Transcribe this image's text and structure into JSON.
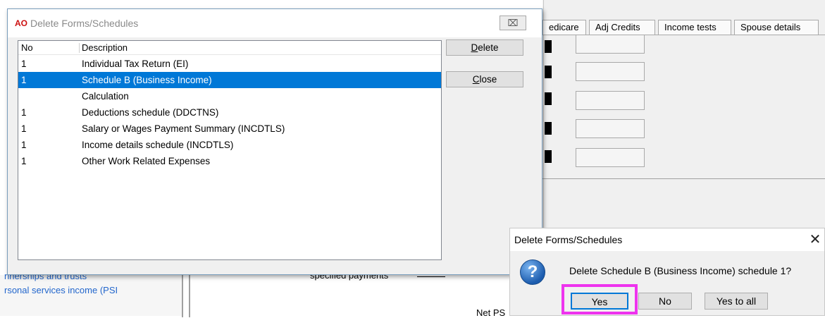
{
  "background": {
    "tabs": [
      "edicare",
      "Adj Credits",
      "Income tests",
      "Spouse details"
    ],
    "links": [
      "nnerships and trusts",
      "rsonal services income (PSI"
    ],
    "specified_payments_label": "specified payments",
    "net_psi_label": "Net PS"
  },
  "dialog": {
    "logo": "AO",
    "title": "Delete Forms/Schedules",
    "close_icon": "⌧",
    "columns": {
      "no": "No",
      "description": "Description"
    },
    "rows": [
      {
        "no": "1",
        "description": "Individual Tax Return (EI)"
      },
      {
        "no": "1",
        "description": "Schedule B (Business Income)"
      },
      {
        "no": "",
        "description": "Calculation"
      },
      {
        "no": "1",
        "description": "Deductions schedule (DDCTNS)"
      },
      {
        "no": "1",
        "description": "Salary or Wages Payment Summary (INCDTLS)"
      },
      {
        "no": "1",
        "description": "Income details schedule (INCDTLS)"
      },
      {
        "no": "1",
        "description": "Other Work Related Expenses"
      }
    ],
    "selected_index": 1,
    "delete_button": {
      "mnemonic": "D",
      "rest": "elete"
    },
    "close_button": {
      "mnemonic": "C",
      "rest": "lose"
    }
  },
  "confirm": {
    "title": "Delete Forms/Schedules",
    "close_icon": "✕",
    "icon": "?",
    "message": "Delete Schedule B (Business Income) schedule 1?",
    "buttons": {
      "yes": "Yes",
      "no": "No",
      "yes_to_all": "Yes to all"
    }
  },
  "colors": {
    "selection": "#0078d7",
    "highlight": "#ee33ee",
    "link": "#2266cc"
  }
}
